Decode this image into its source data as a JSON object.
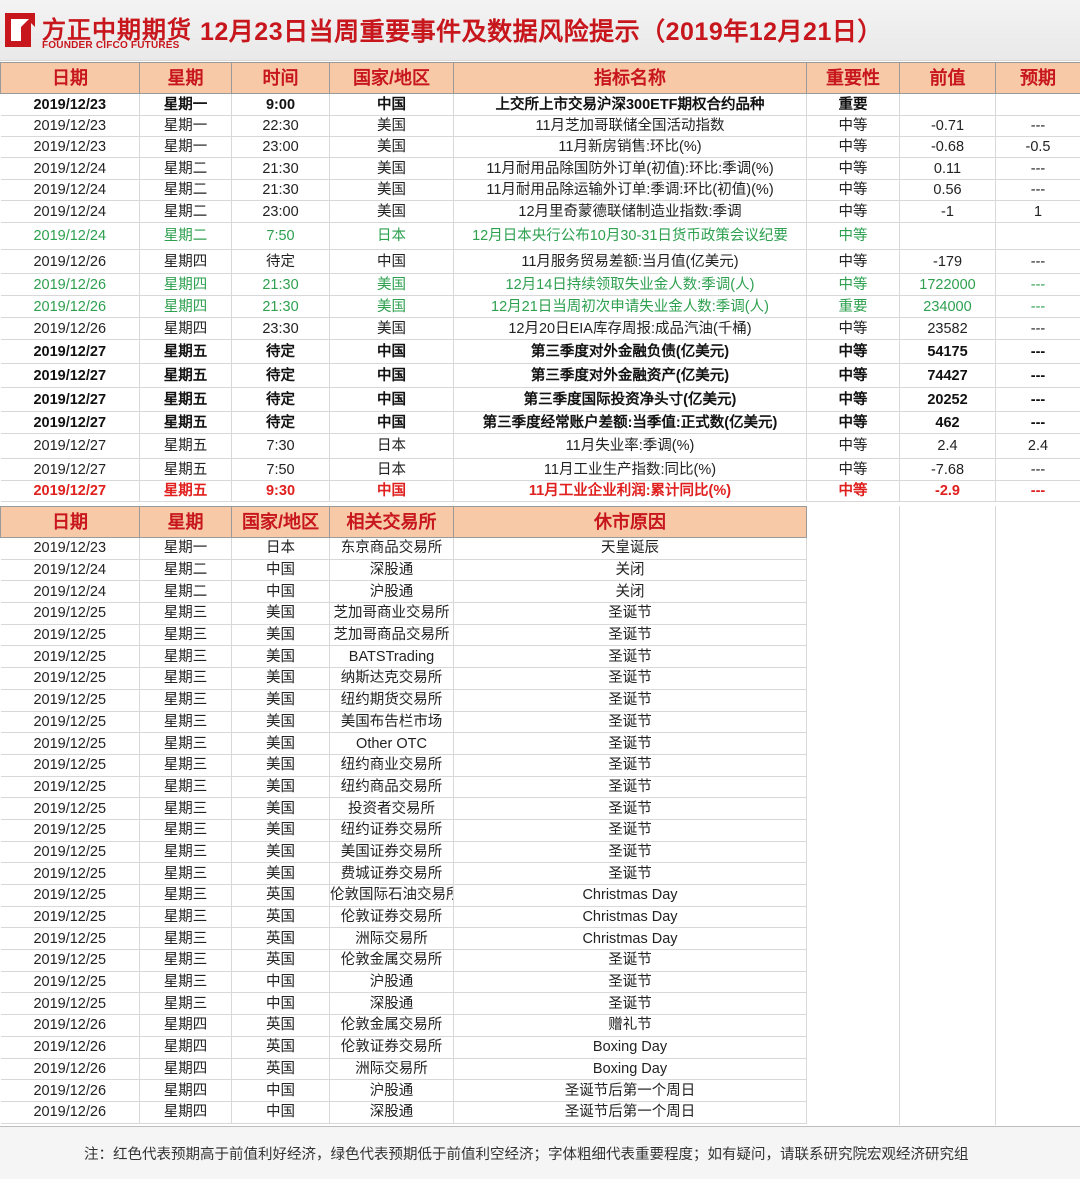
{
  "header": {
    "logo_cn": "方正中期期货",
    "logo_en": "FOUNDER CIFCO FUTURES",
    "title": "12月23日当周重要事件及数据风险提示（2019年12月21日）"
  },
  "events": {
    "headers": [
      "日期",
      "星期",
      "时间",
      "国家/地区",
      "指标名称",
      "重要性",
      "前值",
      "预期"
    ],
    "rows": [
      {
        "style": "bold",
        "cells": [
          "2019/12/23",
          "星期一",
          "9:00",
          "中国",
          "上交所上市交易沪深300ETF期权合约品种",
          "重要",
          "",
          ""
        ]
      },
      {
        "style": "normal",
        "cells": [
          "2019/12/23",
          "星期一",
          "22:30",
          "美国",
          "11月芝加哥联储全国活动指数",
          "中等",
          "-0.71",
          "---"
        ]
      },
      {
        "style": "normal",
        "cells": [
          "2019/12/23",
          "星期一",
          "23:00",
          "美国",
          "11月新房销售:环比(%)",
          "中等",
          "-0.68",
          "-0.5"
        ]
      },
      {
        "style": "normal",
        "cells": [
          "2019/12/24",
          "星期二",
          "21:30",
          "美国",
          "11月耐用品除国防外订单(初值):环比:季调(%)",
          "中等",
          "0.11",
          "---"
        ]
      },
      {
        "style": "normal",
        "cells": [
          "2019/12/24",
          "星期二",
          "21:30",
          "美国",
          "11月耐用品除运输外订单:季调:环比(初值)(%)",
          "中等",
          "0.56",
          "---"
        ]
      },
      {
        "style": "normal",
        "cells": [
          "2019/12/24",
          "星期二",
          "23:00",
          "美国",
          "12月里奇蒙德联储制造业指数:季调",
          "中等",
          "-1",
          "1"
        ]
      },
      {
        "style": "green",
        "cells": [
          "2019/12/24",
          "星期二",
          "7:50",
          "日本",
          "12月日本央行公布10月30-31日货币政策会议纪要",
          "中等",
          "",
          ""
        ]
      },
      {
        "style": "normal",
        "cells": [
          "2019/12/26",
          "星期四",
          "待定",
          "中国",
          "11月服务贸易差额:当月值(亿美元)",
          "中等",
          "-179",
          "---"
        ]
      },
      {
        "style": "green",
        "cells": [
          "2019/12/26",
          "星期四",
          "21:30",
          "美国",
          "12月14日持续领取失业金人数:季调(人)",
          "中等",
          "1722000",
          "---"
        ]
      },
      {
        "style": "green",
        "cells": [
          "2019/12/26",
          "星期四",
          "21:30",
          "美国",
          "12月21日当周初次申请失业金人数:季调(人)",
          "重要",
          "234000",
          "---"
        ]
      },
      {
        "style": "normal",
        "cells": [
          "2019/12/26",
          "星期四",
          "23:30",
          "美国",
          "12月20日EIA库存周报:成品汽油(千桶)",
          "中等",
          "23582",
          "---"
        ]
      },
      {
        "style": "bold",
        "cells": [
          "2019/12/27",
          "星期五",
          "待定",
          "中国",
          "第三季度对外金融负债(亿美元)",
          "中等",
          "54175",
          "---"
        ]
      },
      {
        "style": "bold",
        "cells": [
          "2019/12/27",
          "星期五",
          "待定",
          "中国",
          "第三季度对外金融资产(亿美元)",
          "中等",
          "74427",
          "---"
        ]
      },
      {
        "style": "bold",
        "cells": [
          "2019/12/27",
          "星期五",
          "待定",
          "中国",
          "第三季度国际投资净头寸(亿美元)",
          "中等",
          "20252",
          "---"
        ]
      },
      {
        "style": "bold",
        "cells": [
          "2019/12/27",
          "星期五",
          "待定",
          "中国",
          "第三季度经常账户差额:当季值:正式数(亿美元)",
          "中等",
          "462",
          "---"
        ]
      },
      {
        "style": "normal",
        "cells": [
          "2019/12/27",
          "星期五",
          "7:30",
          "日本",
          "11月失业率:季调(%)",
          "中等",
          "2.4",
          "2.4"
        ]
      },
      {
        "style": "normal",
        "cells": [
          "2019/12/27",
          "星期五",
          "7:50",
          "日本",
          "11月工业生产指数:同比(%)",
          "中等",
          "-7.68",
          "---"
        ]
      },
      {
        "style": "red",
        "cells": [
          "2019/12/27",
          "星期五",
          "9:30",
          "中国",
          "11月工业企业利润:累计同比(%)",
          "中等",
          "-2.9",
          "---"
        ]
      }
    ]
  },
  "closures": {
    "headers": [
      "日期",
      "星期",
      "国家/地区",
      "相关交易所",
      "休市原因"
    ],
    "rows": [
      [
        "2019/12/23",
        "星期一",
        "日本",
        "东京商品交易所",
        "天皇诞辰"
      ],
      [
        "2019/12/24",
        "星期二",
        "中国",
        "深股通",
        "关闭"
      ],
      [
        "2019/12/24",
        "星期二",
        "中国",
        "沪股通",
        "关闭"
      ],
      [
        "2019/12/25",
        "星期三",
        "美国",
        "芝加哥商业交易所",
        "圣诞节"
      ],
      [
        "2019/12/25",
        "星期三",
        "美国",
        "芝加哥商品交易所",
        "圣诞节"
      ],
      [
        "2019/12/25",
        "星期三",
        "美国",
        "BATSTrading",
        "圣诞节"
      ],
      [
        "2019/12/25",
        "星期三",
        "美国",
        "纳斯达克交易所",
        "圣诞节"
      ],
      [
        "2019/12/25",
        "星期三",
        "美国",
        "纽约期货交易所",
        "圣诞节"
      ],
      [
        "2019/12/25",
        "星期三",
        "美国",
        "美国布告栏市场",
        "圣诞节"
      ],
      [
        "2019/12/25",
        "星期三",
        "美国",
        "Other OTC",
        "圣诞节"
      ],
      [
        "2019/12/25",
        "星期三",
        "美国",
        "纽约商业交易所",
        "圣诞节"
      ],
      [
        "2019/12/25",
        "星期三",
        "美国",
        "纽约商品交易所",
        "圣诞节"
      ],
      [
        "2019/12/25",
        "星期三",
        "美国",
        "投资者交易所",
        "圣诞节"
      ],
      [
        "2019/12/25",
        "星期三",
        "美国",
        "纽约证券交易所",
        "圣诞节"
      ],
      [
        "2019/12/25",
        "星期三",
        "美国",
        "美国证券交易所",
        "圣诞节"
      ],
      [
        "2019/12/25",
        "星期三",
        "美国",
        "费城证券交易所",
        "圣诞节"
      ],
      [
        "2019/12/25",
        "星期三",
        "英国",
        "伦敦国际石油交易所",
        "Christmas Day"
      ],
      [
        "2019/12/25",
        "星期三",
        "英国",
        "伦敦证券交易所",
        "Christmas Day"
      ],
      [
        "2019/12/25",
        "星期三",
        "英国",
        "洲际交易所",
        "Christmas Day"
      ],
      [
        "2019/12/25",
        "星期三",
        "英国",
        "伦敦金属交易所",
        "圣诞节"
      ],
      [
        "2019/12/25",
        "星期三",
        "中国",
        "沪股通",
        "圣诞节"
      ],
      [
        "2019/12/25",
        "星期三",
        "中国",
        "深股通",
        "圣诞节"
      ],
      [
        "2019/12/26",
        "星期四",
        "英国",
        "伦敦金属交易所",
        "赠礼节"
      ],
      [
        "2019/12/26",
        "星期四",
        "英国",
        "伦敦证券交易所",
        "Boxing Day"
      ],
      [
        "2019/12/26",
        "星期四",
        "英国",
        "洲际交易所",
        "Boxing Day"
      ],
      [
        "2019/12/26",
        "星期四",
        "中国",
        "沪股通",
        "圣诞节后第一个周日"
      ],
      [
        "2019/12/26",
        "星期四",
        "中国",
        "深股通",
        "圣诞节后第一个周日"
      ]
    ]
  },
  "footer": {
    "note": "注：红色代表预期高于前值利好经济，绿色代表预期低于前值利空经济；字体粗细代表重要程度；如有疑问，请联系研究院宏观经济研究组"
  },
  "colors": {
    "brand_red": "#c8161d",
    "header_fill": "#f7c9a7",
    "positive_red": "#e0201e",
    "negative_green": "#2ea04f"
  }
}
